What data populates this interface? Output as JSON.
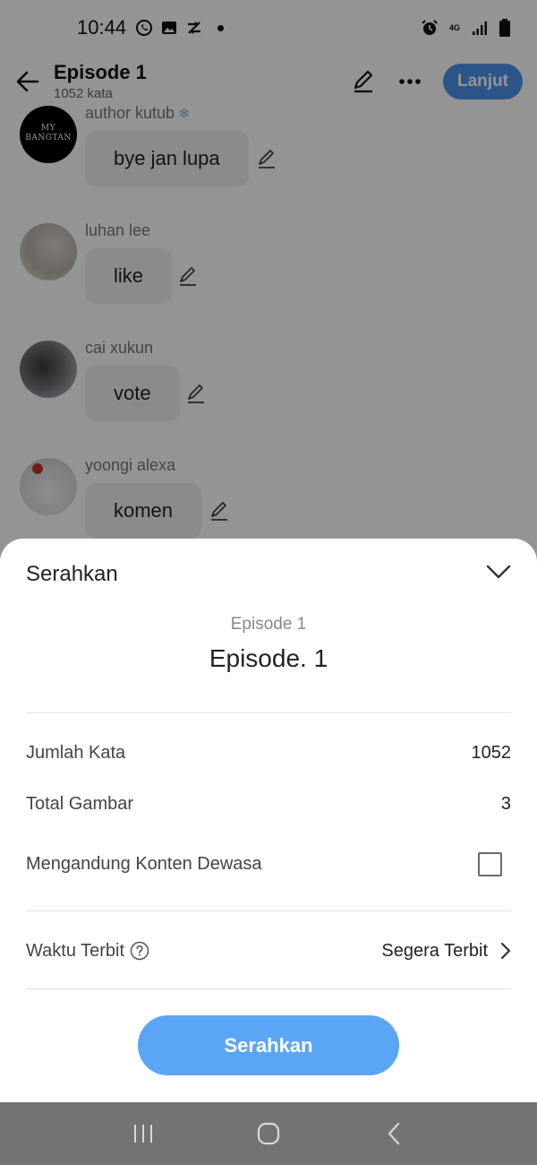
{
  "status_bar": {
    "time": "10:44",
    "left_icons": [
      "whatsapp-icon",
      "gallery-icon",
      "sync-icon"
    ],
    "right_icons": [
      "alarm-icon",
      "4g-icon",
      "signal-icon",
      "battery-icon"
    ],
    "network": "4G"
  },
  "app_bar": {
    "title": "Episode 1",
    "subtitle": "1052 kata",
    "next_label": "Lanjut"
  },
  "messages": [
    {
      "sender": "author kutub",
      "sender_emoji": "❄",
      "text": "bye jan lupa",
      "avatar_text": "MY\nBANGTAN"
    },
    {
      "sender": "luhan lee",
      "text": "like"
    },
    {
      "sender": "cai xukun",
      "text": "vote"
    },
    {
      "sender": "yoongi alexa",
      "text": "komen"
    }
  ],
  "sheet": {
    "title": "Serahkan",
    "episode_label": "Episode 1",
    "episode_name": "Episode. 1",
    "rows": {
      "word_count_label": "Jumlah Kata",
      "word_count_value": "1052",
      "images_label": "Total Gambar",
      "images_value": "3",
      "adult_label": "Mengandung Konten Dewasa",
      "adult_checked": false,
      "publish_label": "Waktu Terbit",
      "publish_value": "Segera Terbit"
    },
    "submit_label": "Serahkan"
  },
  "colors": {
    "accent": "#5ba5f6",
    "lanjut": "#4d95ee",
    "navbar": "#737373"
  }
}
